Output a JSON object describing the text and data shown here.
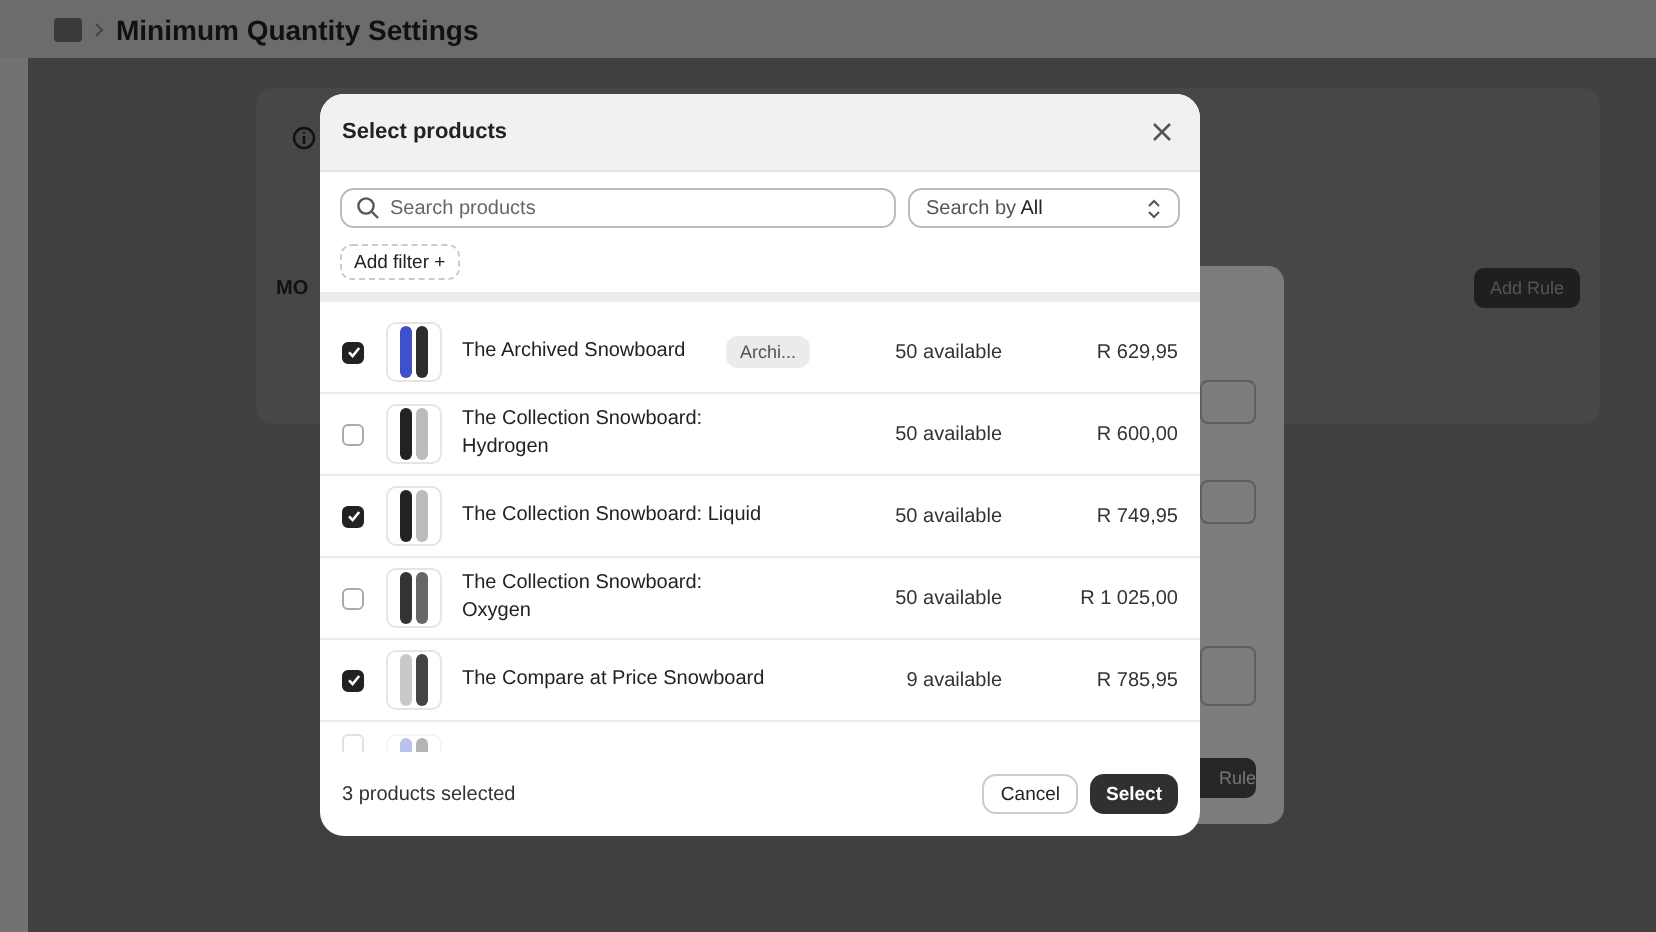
{
  "page": {
    "title": "Minimum Quantity Settings",
    "card_label": "MO",
    "add_rule_button": "Add Rule"
  },
  "back_dialog": {
    "button": "Rule"
  },
  "modal": {
    "title": "Select products",
    "search": {
      "placeholder": "Search products"
    },
    "search_by": {
      "label": "Search by",
      "value": "All"
    },
    "add_filter": "Add filter +",
    "products": [
      {
        "name": "The Archived Snowboard",
        "badge": "Archi...",
        "stock": "50 available",
        "price": "R 629,95",
        "checked": true,
        "kind": "blue"
      },
      {
        "name": "The Collection Snowboard: Hydrogen",
        "stock": "50 available",
        "price": "R 600,00",
        "checked": false,
        "kind": "mono"
      },
      {
        "name": "The Collection Snowboard: Liquid",
        "stock": "50 available",
        "price": "R 749,95",
        "checked": true,
        "kind": "mono"
      },
      {
        "name": "The Collection Snowboard: Oxygen",
        "stock": "50 available",
        "price": "R 1 025,00",
        "checked": false,
        "kind": "dark"
      },
      {
        "name": "The Compare at Price Snowboard",
        "stock": "9 available",
        "price": "R 785,95",
        "checked": true,
        "kind": "light"
      },
      {
        "checked": false,
        "kind": "blue",
        "partial": true
      }
    ],
    "footer": {
      "count": "3 products selected",
      "cancel": "Cancel",
      "select": "Select"
    }
  }
}
